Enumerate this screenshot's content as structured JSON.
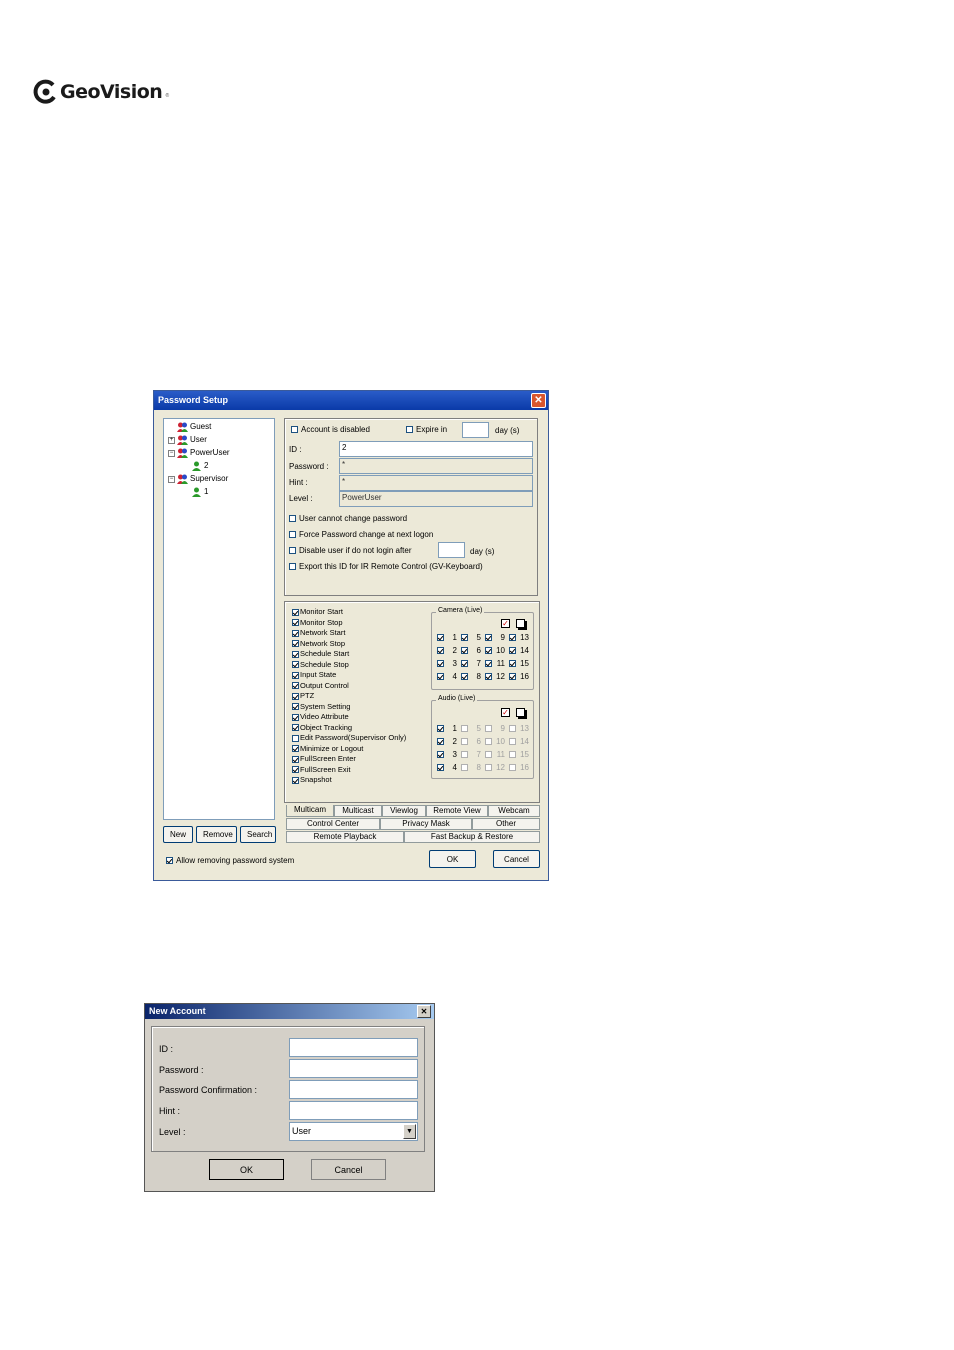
{
  "logo": {
    "name": "GeoVision",
    "tm": "®"
  },
  "password_setup": {
    "title": "Password Setup",
    "tree": [
      {
        "label": "Guest",
        "level": 0,
        "exp": ""
      },
      {
        "label": "User",
        "level": 0,
        "exp": "+"
      },
      {
        "label": "PowerUser",
        "level": 0,
        "exp": "−"
      },
      {
        "label": "2",
        "level": 1,
        "exp": ""
      },
      {
        "label": "Supervisor",
        "level": 0,
        "exp": "−"
      },
      {
        "label": "1",
        "level": 1,
        "exp": ""
      }
    ],
    "buttons": {
      "new": "New",
      "remove": "Remove",
      "search": "Search",
      "ok": "OK",
      "cancel": "Cancel"
    },
    "account": {
      "disabled_label": "Account is disabled",
      "expire_label": "Expire in",
      "expire_unit": "day (s)",
      "id_label": "ID :",
      "id_value": "2",
      "password_label": "Password :",
      "password_value": "*",
      "hint_label": "Hint :",
      "hint_value": "*",
      "level_label": "Level :",
      "level_value": "PowerUser",
      "opt1": "User cannot change password",
      "opt2": "Force Password change at next logon",
      "opt3": "Disable user if do not login after",
      "opt3_unit": "day (s)",
      "opt4": "Export this ID for IR Remote Control (GV-Keyboard)"
    },
    "permissions": [
      {
        "label": "Monitor Start",
        "checked": true
      },
      {
        "label": "Monitor Stop",
        "checked": true
      },
      {
        "label": "Network Start",
        "checked": true
      },
      {
        "label": "Network Stop",
        "checked": true
      },
      {
        "label": "Schedule Start",
        "checked": true
      },
      {
        "label": "Schedule Stop",
        "checked": true
      },
      {
        "label": "Input State",
        "checked": true
      },
      {
        "label": "Output Control",
        "checked": true
      },
      {
        "label": "PTZ",
        "checked": true
      },
      {
        "label": "System Setting",
        "checked": true
      },
      {
        "label": "Video Attribute",
        "checked": true
      },
      {
        "label": "Object Tracking",
        "checked": true
      },
      {
        "label": "Edit Password(Supervisor Only)",
        "checked": false
      },
      {
        "label": "Minimize or Logout",
        "checked": true
      },
      {
        "label": "FullScreen Enter",
        "checked": true
      },
      {
        "label": "FullScreen Exit",
        "checked": true
      },
      {
        "label": "Snapshot",
        "checked": true
      }
    ],
    "camera_group": "Camera (Live)",
    "audio_group": "Audio (Live)",
    "cameras": [
      "1",
      "5",
      "9",
      "13",
      "2",
      "6",
      "10",
      "14",
      "3",
      "7",
      "11",
      "15",
      "4",
      "8",
      "12",
      "16"
    ],
    "audio_enabled": [
      "1",
      "2",
      "3",
      "4"
    ],
    "tabs_row1": [
      "Multicam",
      "Multicast",
      "Viewlog",
      "Remote View",
      "Webcam"
    ],
    "tabs_row2": [
      "Control Center",
      "Privacy Mask",
      "Other"
    ],
    "tabs_row3": [
      "Remote Playback",
      "Fast Backup & Restore"
    ],
    "allow_label": "Allow removing password system"
  },
  "new_account": {
    "title": "New Account",
    "id_label": "ID :",
    "password_label": "Password :",
    "confirm_label": "Password Confirmation :",
    "hint_label": "Hint :",
    "level_label": "Level :",
    "level_value": "User",
    "ok": "OK",
    "cancel": "Cancel"
  }
}
